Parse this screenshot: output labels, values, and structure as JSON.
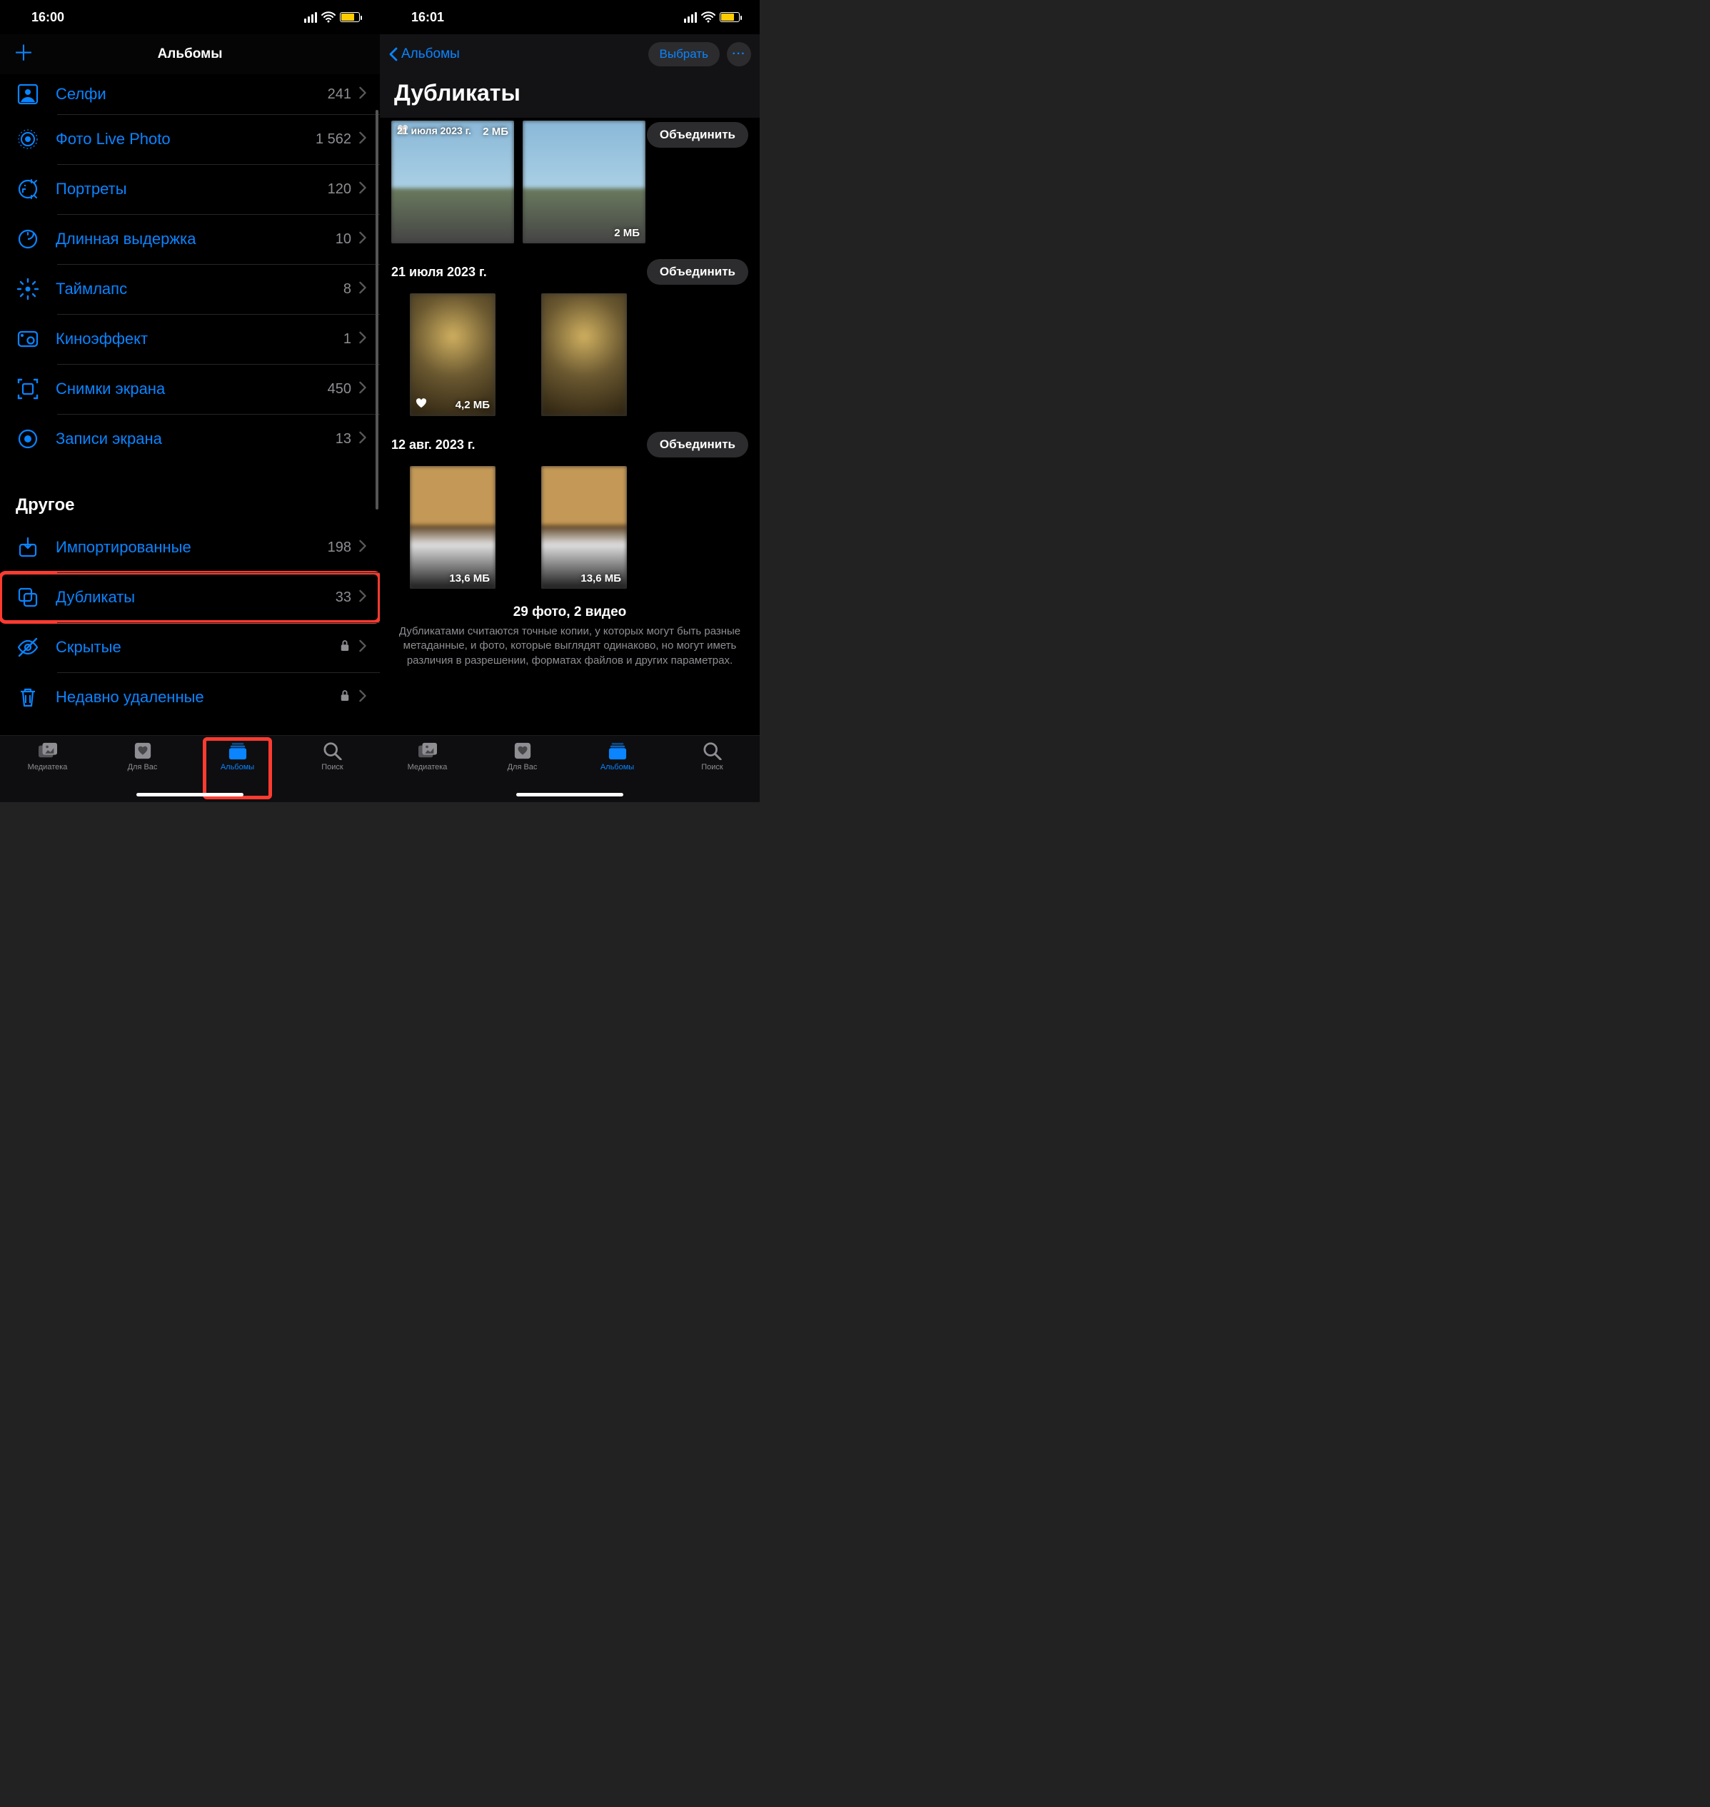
{
  "phone1": {
    "time": "16:00",
    "nav_title": "Альбомы",
    "add_btn": "＋",
    "rows": [
      {
        "icon": "selfie",
        "label": "Селфи",
        "count": "241"
      },
      {
        "icon": "live",
        "label": "Фото Live Photo",
        "count": "1 562"
      },
      {
        "icon": "portrait",
        "label": "Портреты",
        "count": "120"
      },
      {
        "icon": "longexp",
        "label": "Длинная выдержка",
        "count": "10"
      },
      {
        "icon": "timelapse",
        "label": "Таймлапс",
        "count": "8"
      },
      {
        "icon": "cinematic",
        "label": "Киноэффект",
        "count": "1"
      },
      {
        "icon": "screenshot",
        "label": "Снимки экрана",
        "count": "450"
      },
      {
        "icon": "screenrec",
        "label": "Записи экрана",
        "count": "13"
      }
    ],
    "other_header": "Другое",
    "other_rows": [
      {
        "icon": "import",
        "label": "Импортированные",
        "count": "198",
        "tail": "chev"
      },
      {
        "icon": "dup",
        "label": "Дубликаты",
        "count": "33",
        "tail": "chev",
        "hl": true
      },
      {
        "icon": "hidden",
        "label": "Скрытые",
        "tail": "lock"
      },
      {
        "icon": "trash",
        "label": "Недавно удаленные",
        "tail": "lock"
      }
    ],
    "tabs": [
      "Медиатека",
      "Для Вас",
      "Альбомы",
      "Поиск"
    ]
  },
  "phone2": {
    "time": "16:01",
    "back_label": "Альбомы",
    "select_btn": "Выбрать",
    "title": "Дубликаты",
    "merge_btn": "Объединить",
    "group1": {
      "date": "21 июля 2023 г.",
      "size1": "2 МБ",
      "size2": "2 МБ"
    },
    "group2": {
      "date": "21 июля 2023 г.",
      "size1": "4,2 МБ"
    },
    "group3": {
      "date": "12 авг. 2023 г.",
      "size1": "13,6 МБ",
      "size2": "13,6 МБ"
    },
    "summary_title": "29 фото, 2 видео",
    "summary_text": "Дубликатами считаются точные копии, у которых могут быть разные метаданные, и фото, которые выглядят одинаково, но могут иметь различия в разрешении, форматах файлов и других параметрах.",
    "tabs": [
      "Медиатека",
      "Для Вас",
      "Альбомы",
      "Поиск"
    ]
  }
}
